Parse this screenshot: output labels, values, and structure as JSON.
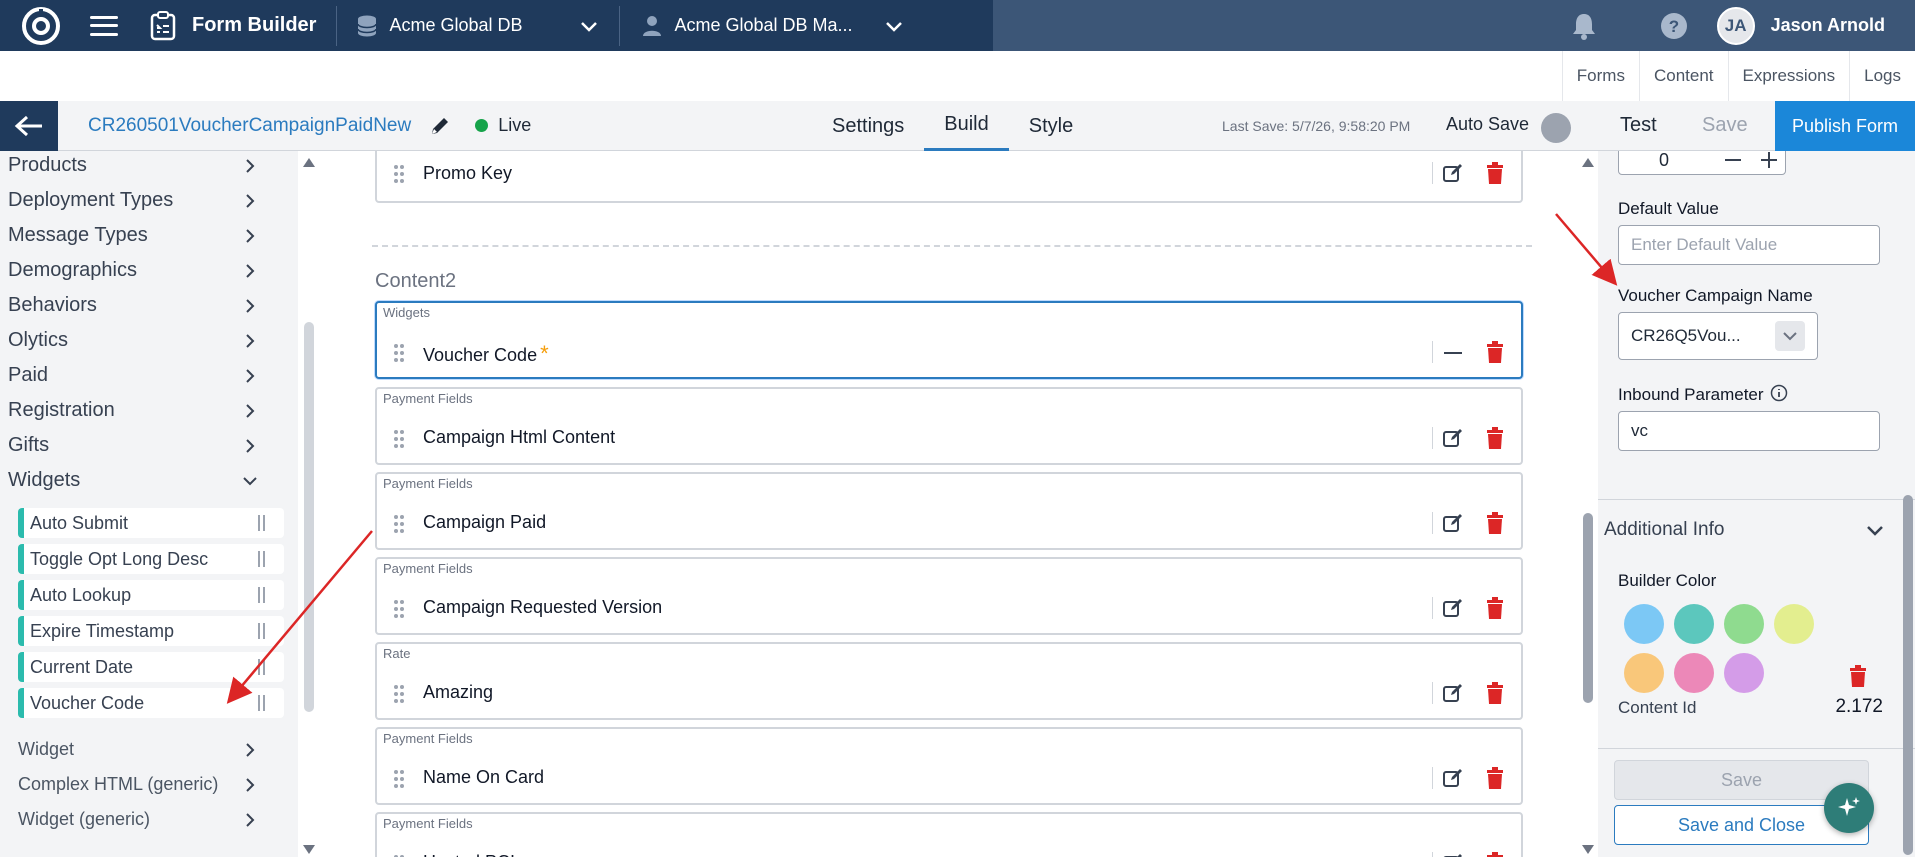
{
  "topbar": {
    "app_title": "Form Builder",
    "database": "Acme Global DB",
    "database_manager": "Acme Global DB Ma...",
    "user_initials": "JA",
    "user_name": "Jason Arnold"
  },
  "subnav": {
    "items": [
      "Forms",
      "Content",
      "Expressions",
      "Logs"
    ]
  },
  "formbar": {
    "form_name": "CR260501VoucherCampaignPaidNew",
    "status": "Live",
    "status_color": "#16a34a",
    "tabs": [
      "Settings",
      "Build",
      "Style"
    ],
    "active_tab": "Build",
    "last_save": "Last Save: 5/7/26, 9:58:20 PM",
    "auto_save_label": "Auto Save",
    "test_label": "Test",
    "save_label": "Save",
    "publish_label": "Publish Form"
  },
  "sidebar": {
    "categories": [
      "Products",
      "Deployment Types",
      "Message Types",
      "Demographics",
      "Behaviors",
      "Olytics",
      "Paid",
      "Registration",
      "Gifts",
      "Widgets"
    ],
    "widgets": [
      "Auto Submit",
      "Toggle Opt Long Desc",
      "Auto Lookup",
      "Expire Timestamp",
      "Current Date",
      "Voucher Code"
    ],
    "more_categories": [
      "Widget",
      "Complex HTML (generic)",
      "Widget (generic)"
    ]
  },
  "canvas": {
    "top_field": "Promo Key",
    "section_label": "Content2",
    "fields": [
      {
        "group": "Widgets",
        "label": "Voucher Code",
        "required": "*"
      },
      {
        "group": "Payment Fields",
        "label": "Campaign Html Content"
      },
      {
        "group": "Payment Fields",
        "label": "Campaign Paid"
      },
      {
        "group": "Payment Fields",
        "label": "Campaign Requested Version"
      },
      {
        "group": "Rate",
        "label": "Amazing"
      },
      {
        "group": "Payment Fields",
        "label": "Name On Card"
      },
      {
        "group": "Payment Fields",
        "label": "Hosted PCI"
      }
    ]
  },
  "rpanel": {
    "number_value": "0",
    "default_value_label": "Default Value",
    "default_value_placeholder": "Enter Default Value",
    "voucher_campaign_label": "Voucher Campaign Name",
    "voucher_campaign_value": "CR26Q5Vou...",
    "inbound_param_label": "Inbound Parameter",
    "inbound_param_value": "vc",
    "additional_info_label": "Additional Info",
    "builder_color_label": "Builder Color",
    "colors": [
      "#7cc8f5",
      "#5cc7bd",
      "#8fdb8f",
      "#e3ee8f",
      "#f9c77a",
      "#ec88b8",
      "#d49ce8"
    ],
    "content_id_label": "Content Id",
    "content_id_value": "2.172",
    "save_label": "Save",
    "save_close_label": "Save and Close"
  }
}
